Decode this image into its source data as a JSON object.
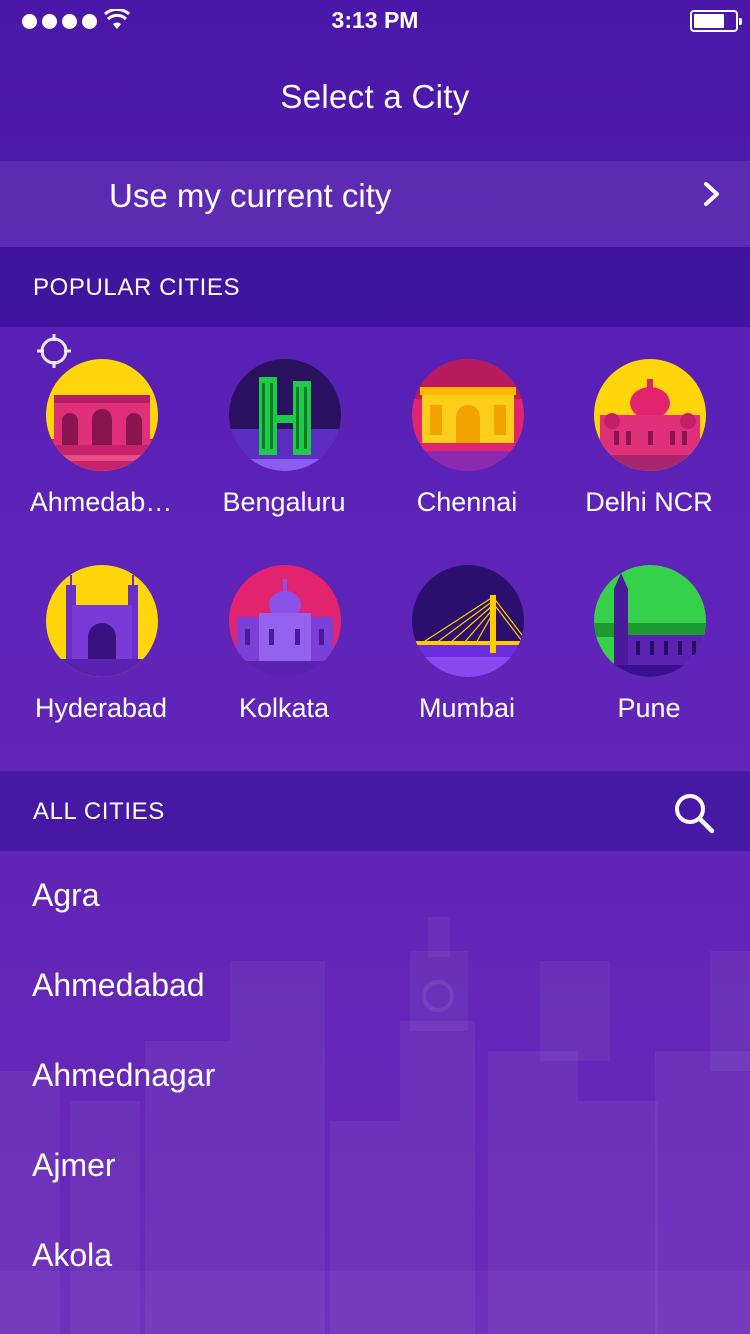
{
  "status_bar": {
    "time": "3:13 PM",
    "signal_icon": "signal-dots-icon",
    "wifi_icon": "wifi-icon",
    "battery_icon": "battery-icon"
  },
  "header": {
    "title": "Select a City"
  },
  "current_city": {
    "label": "Use my current city",
    "icon": "crosshair-location-icon",
    "chevron": "chevron-right-icon"
  },
  "popular": {
    "title": "POPULAR CITIES",
    "cities": [
      {
        "name": "Ahmedab…",
        "icon": "ahmedabad-landmark-icon"
      },
      {
        "name": "Bengaluru",
        "icon": "bengaluru-landmark-icon"
      },
      {
        "name": "Chennai",
        "icon": "chennai-landmark-icon"
      },
      {
        "name": "Delhi NCR",
        "icon": "delhi-landmark-icon"
      },
      {
        "name": "Hyderabad",
        "icon": "hyderabad-charminar-icon"
      },
      {
        "name": "Kolkata",
        "icon": "kolkata-victoria-icon"
      },
      {
        "name": "Mumbai",
        "icon": "mumbai-sealink-icon"
      },
      {
        "name": "Pune",
        "icon": "pune-tower-icon"
      }
    ]
  },
  "all_cities": {
    "title": "ALL CITIES",
    "search_icon": "search-icon",
    "items": [
      "Agra",
      "Ahmedabad",
      "Ahmednagar",
      "Ajmer",
      "Akola"
    ]
  },
  "colors": {
    "background": "#4a17a8",
    "section_header": "#3a10a0",
    "text": "#ffffff"
  }
}
